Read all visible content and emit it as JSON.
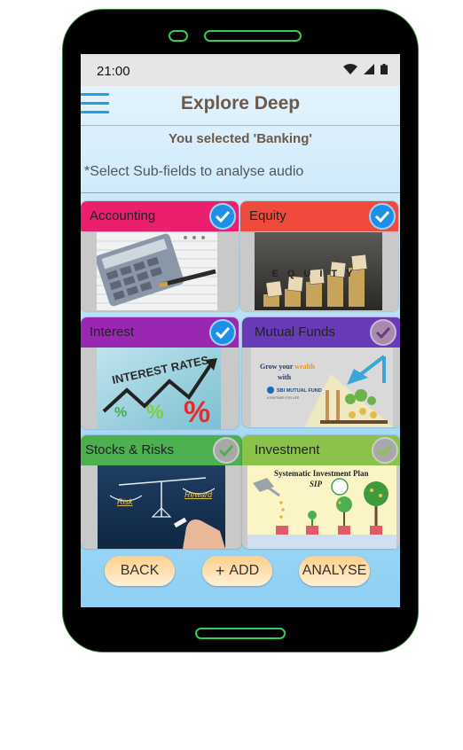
{
  "status_bar": {
    "time": "21:00",
    "icons": [
      "wifi-icon",
      "signal-icon",
      "battery-icon"
    ]
  },
  "header": {
    "title": "Explore Deep",
    "menu_icon": "hamburger-menu-icon"
  },
  "selection": {
    "text": "You selected  'Banking'"
  },
  "hint": "*Select Sub-fields to analyse audio",
  "subfields": [
    {
      "label": "Accounting",
      "color": "#ea1f6e",
      "checked": true,
      "image": "calculator-and-pen-illustration"
    },
    {
      "label": "Equity",
      "color": "#f04a3d",
      "checked": true,
      "image": "equity-letter-blocks-on-coins"
    },
    {
      "label": "Interest",
      "color": "#9a27b1",
      "checked": true,
      "image": "interest-rates-chalkboard-arrow"
    },
    {
      "label": "Mutual Funds",
      "color": "#673ab7",
      "checked": false,
      "image": "sbi-mutual-fund-banner",
      "image_text": {
        "line1": "Grow your",
        "highlight": "wealth",
        "line2": "with",
        "brand": "SBI MUTUAL FUND",
        "tagline": "A PARTNER FOR LIFE"
      }
    },
    {
      "label": "Stocks & Risks",
      "color": "#4caf50",
      "checked": false,
      "image": "risk-reward-balance-chalkboard",
      "image_text": {
        "left": "Risk",
        "right": "Reward"
      }
    },
    {
      "label": "Investment",
      "color": "#8bc34a",
      "checked": false,
      "image": "sip-plants-growth",
      "image_text": {
        "title": "Systematic Investment Plan",
        "subtitle": "SIP"
      }
    }
  ],
  "image_text": {
    "interest": "INTEREST RATES",
    "equity": "EQUITY",
    "percent": "%"
  },
  "buttons": {
    "back": "BACK",
    "add": "ADD",
    "add_icon": "plus-icon",
    "analyse": "ANALYSE"
  }
}
